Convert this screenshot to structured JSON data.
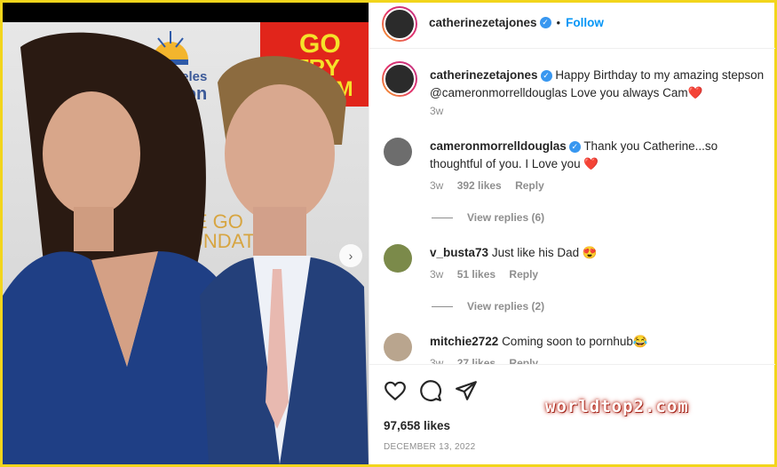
{
  "post": {
    "author": "catherinezetajones",
    "follow_label": "Follow",
    "dot": "•",
    "caption": {
      "author": "catherinezetajones",
      "text_before": "Happy Birthday to my amazing stepson",
      "mention": "@cameronmorrelldouglas",
      "text_after": "Love you always Cam",
      "emoji": "❤️",
      "time": "3w"
    }
  },
  "photo": {
    "sponsor_gold_1": "Angeles",
    "sponsor_gold_2": "ssion",
    "sponsor_red_1": "GO",
    "sponsor_red_2": "NTRY",
    "sponsor_red_3": "FM",
    "sponsor_lower_1": "HE GO",
    "sponsor_lower_2": "UNDATI",
    "next_icon": "›"
  },
  "comments": [
    {
      "user": "cameronmorrelldouglas",
      "verified": true,
      "text": "Thank you Catherine...so thoughtful of you. I Love you",
      "emoji": "❤️",
      "time": "3w",
      "likes": "392 likes",
      "reply": "Reply",
      "view_replies": "View replies (6)"
    },
    {
      "user": "v_busta73",
      "verified": false,
      "text": "Just like his Dad",
      "emoji": "😍",
      "time": "3w",
      "likes": "51 likes",
      "reply": "Reply",
      "view_replies": "View replies (2)"
    },
    {
      "user": "mitchie2722",
      "verified": false,
      "text": "Coming soon to pornhub",
      "emoji": "😂",
      "time": "3w",
      "likes": "27 likes",
      "reply": "Reply"
    }
  ],
  "footer": {
    "likes": "97,658 likes",
    "date": "DECEMBER 13, 2022"
  },
  "watermark": "worldtop2.com",
  "colors": {
    "follow": "#0095f6",
    "verified": "#3897f0",
    "frame": "#f2d51c"
  },
  "icons": [
    "heart-icon",
    "comment-icon",
    "share-icon",
    "verified-icon",
    "chevron-right-icon"
  ]
}
